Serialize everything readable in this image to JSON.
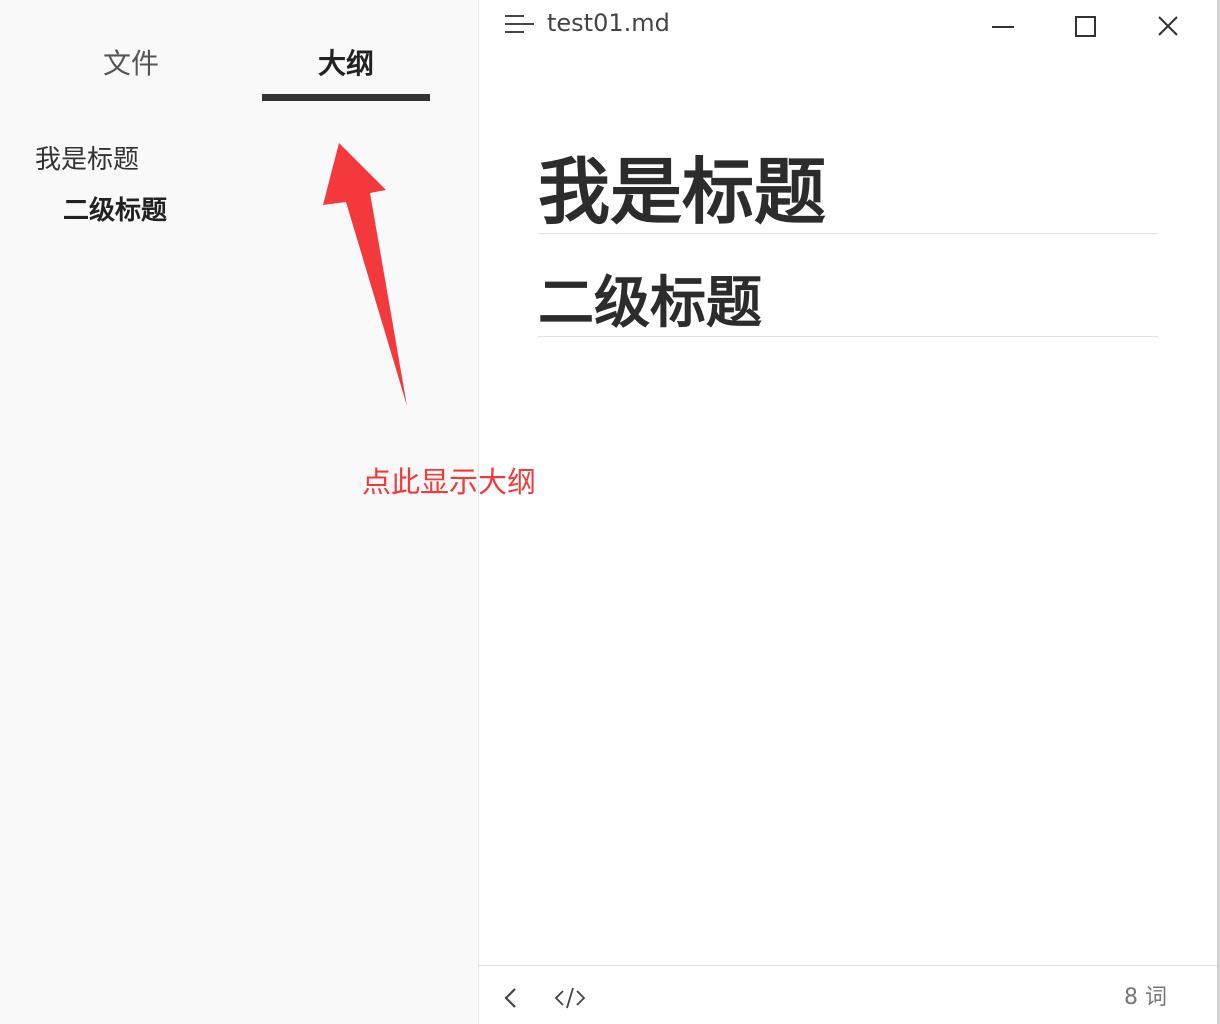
{
  "sidebar": {
    "tabs": [
      {
        "label": "文件",
        "active": false
      },
      {
        "label": "大纲",
        "active": true
      }
    ],
    "outline": [
      {
        "label": "我是标题",
        "level": 1
      },
      {
        "label": "二级标题",
        "level": 2
      }
    ]
  },
  "annotation": {
    "text": "点此显示大纲",
    "color": "#f4393c"
  },
  "titlebar": {
    "filename": "test01.md",
    "menu_icon": "menu-icon",
    "buttons": [
      "minimize-icon",
      "maximize-icon",
      "close-icon"
    ]
  },
  "document": {
    "heading1": "我是标题",
    "heading2": "二级标题"
  },
  "footer": {
    "back_icon": "chevron-left-icon",
    "source_icon": "code-icon",
    "word_count": "8 词"
  }
}
